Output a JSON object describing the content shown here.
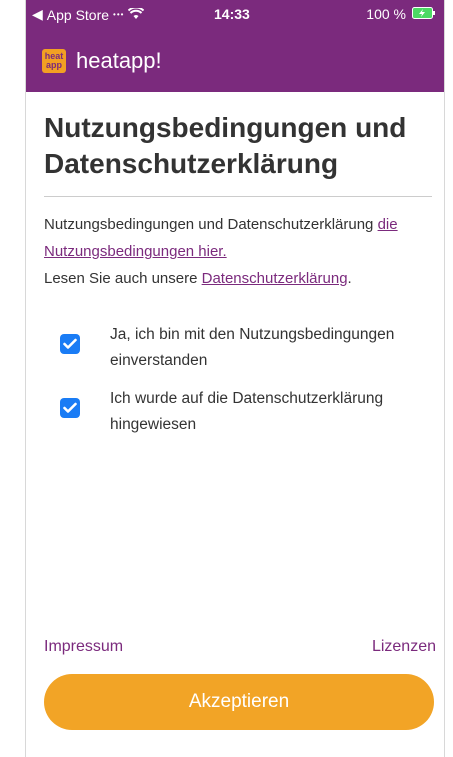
{
  "status_bar": {
    "back_app": "App Store",
    "time": "14:33",
    "battery": "100 %"
  },
  "header": {
    "logo_text": "heat app",
    "app_name": "heatapp!"
  },
  "page": {
    "title": "Nutzungsbedingungen und Datenschutzerklärung",
    "intro_text": "Nutzungsbedingungen und Datenschutzerklärung",
    "terms_link": "die Nutzungsbedingungen hier.",
    "privacy_prefix": "Lesen Sie auch unsere",
    "privacy_link": "Datenschutzerklärung",
    "privacy_suffix": "."
  },
  "checkboxes": [
    {
      "label": "Ja, ich bin mit den Nutzungsbedingungen einverstanden",
      "checked": true
    },
    {
      "label": "Ich wurde auf die Datenschutzerklärung hingewiesen",
      "checked": true
    }
  ],
  "footer": {
    "impressum": "Impressum",
    "licenses": "Lizenzen",
    "accept_button": "Akzeptieren"
  },
  "colors": {
    "brand_purple": "#7b2a7d",
    "accent_orange": "#f2a426",
    "checkbox_blue": "#1a7cf5"
  }
}
